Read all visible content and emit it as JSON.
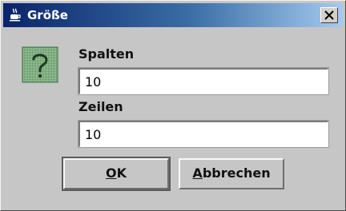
{
  "window": {
    "title": "Größe",
    "close_label": "Close"
  },
  "fields": {
    "columns": {
      "label": "Spalten",
      "value": "10"
    },
    "rows": {
      "label": "Zeilen",
      "value": "10"
    }
  },
  "buttons": {
    "ok": {
      "mnemonic": "O",
      "rest": "K"
    },
    "cancel": {
      "mnemonic": "A",
      "rest": "bbrechen"
    }
  },
  "icons": {
    "app": "java-coffee-cup-icon",
    "question": "question-mark-icon",
    "close": "close-x-icon"
  }
}
